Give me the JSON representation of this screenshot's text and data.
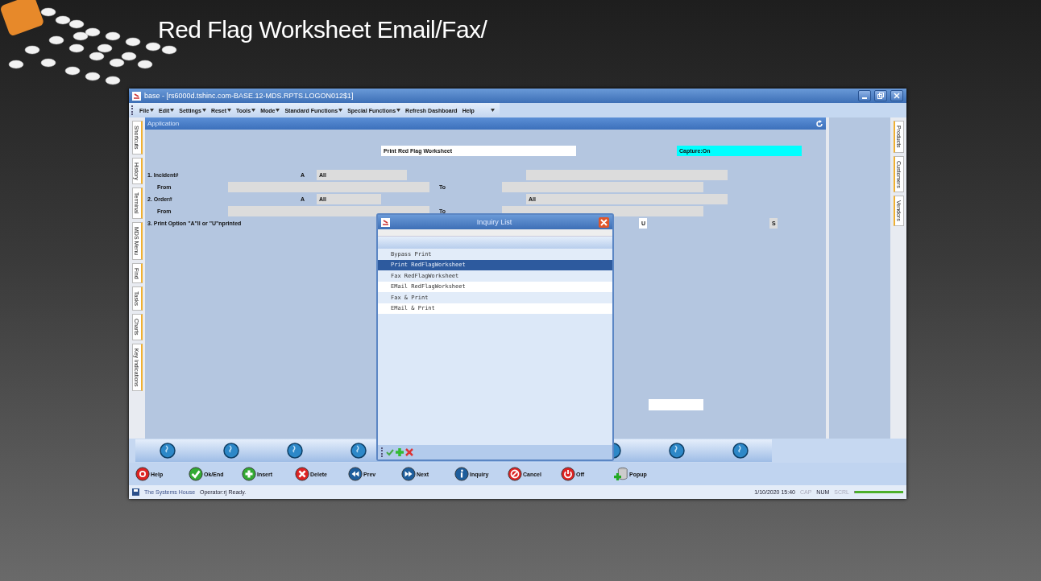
{
  "slide_title": "Red Flag Worksheet Email/Fax/",
  "window": {
    "title": "base - [rs6000d.tshinc.com-BASE.12-MDS.RPTS.LOGON012$1]"
  },
  "menu": [
    {
      "label": "File",
      "dropdown": true
    },
    {
      "label": "Edit",
      "dropdown": true
    },
    {
      "label": "Settings",
      "dropdown": true
    },
    {
      "label": "Reset",
      "dropdown": true
    },
    {
      "label": "Tools",
      "dropdown": true
    },
    {
      "label": "Mode",
      "dropdown": true
    },
    {
      "label": "Standard Functions",
      "dropdown": true
    },
    {
      "label": "Special Functions",
      "dropdown": true
    },
    {
      "label": "Refresh Dashboard",
      "dropdown": false
    },
    {
      "label": "Help",
      "dropdown": false
    }
  ],
  "left_tabs": [
    "Shortcuts",
    "History",
    "Terminal",
    "MDS Menu",
    "Find",
    "Tasks",
    "Charts",
    "Key Indications"
  ],
  "right_tabs": [
    "Products",
    "Customers",
    "Vendors"
  ],
  "panel": {
    "title": "Application"
  },
  "form": {
    "report_title": "Print Red Flag Worksheet",
    "capture": "Capture:On",
    "incident": {
      "label": "1. Incident#",
      "option": "A",
      "value": "All"
    },
    "incident_range": {
      "from": "From",
      "to": "To"
    },
    "order": {
      "label": "2. Order#",
      "option": "A",
      "value": "All",
      "right_value": "All"
    },
    "order_range": {
      "from": "From",
      "to": "To"
    },
    "print_option": {
      "label": "3. Print Option \"A\"ll or \"U\"nprinted",
      "value": "U",
      "extra": "S"
    }
  },
  "dialog": {
    "title": "Inquiry List",
    "items": [
      {
        "label": "Bypass Print",
        "selected": false
      },
      {
        "label": "Print RedFlagWorksheet",
        "selected": true
      },
      {
        "label": "Fax RedFlagWorksheet",
        "selected": false
      },
      {
        "label": "EMail RedFlagWorksheet",
        "selected": false
      },
      {
        "label": "Fax & Print",
        "selected": false
      },
      {
        "label": "EMail & Print",
        "selected": false
      }
    ]
  },
  "toolbar": [
    {
      "kind": "help",
      "label": "Help"
    },
    {
      "kind": "ok",
      "label": "Ok/End"
    },
    {
      "kind": "insert",
      "label": "Insert"
    },
    {
      "kind": "delete",
      "label": "Delete"
    },
    {
      "kind": "prev",
      "label": "Prev"
    },
    {
      "kind": "next",
      "label": "Next"
    },
    {
      "kind": "inquiry",
      "label": "Inquiry"
    },
    {
      "kind": "cancel",
      "label": "Cancel"
    },
    {
      "kind": "off",
      "label": "Off"
    },
    {
      "kind": "popup",
      "label": "Popup"
    }
  ],
  "status_bar": {
    "company": "The Systems House",
    "message": "Operator:rj Ready.",
    "datetime": "1/10/2020 15:40",
    "indicators": [
      {
        "label": "CAP",
        "on": false
      },
      {
        "label": "NUM",
        "on": true
      },
      {
        "label": "SCRL",
        "on": false
      }
    ],
    "progress": {
      "level": 1
    }
  }
}
